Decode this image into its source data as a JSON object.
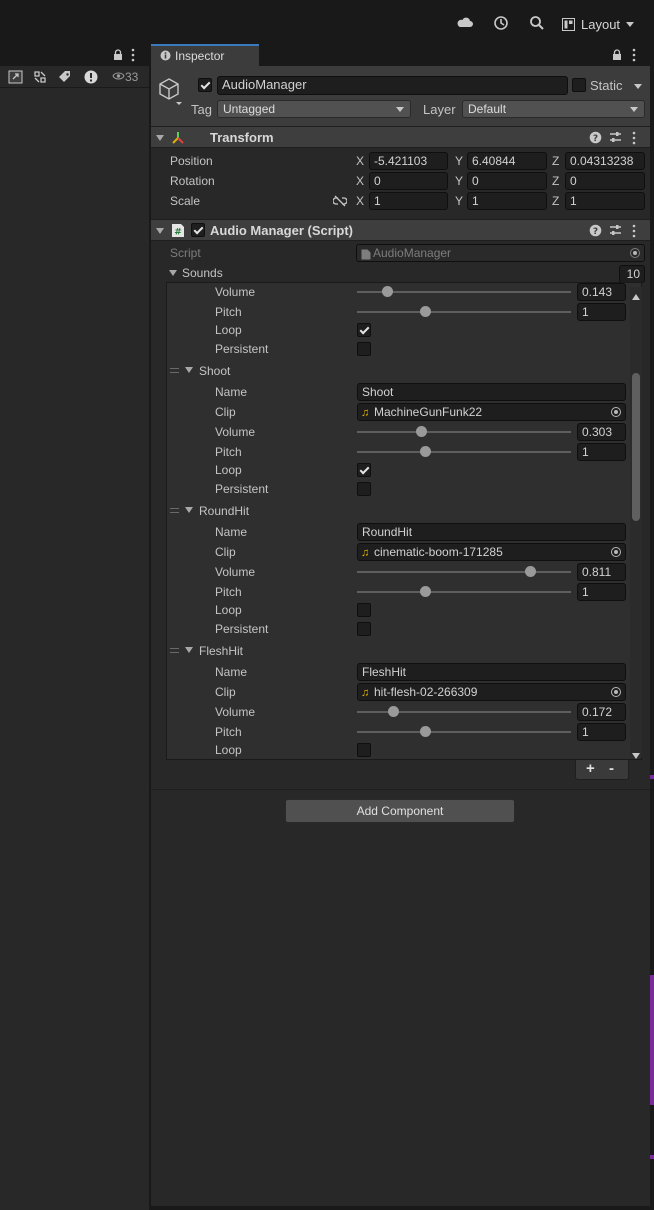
{
  "toolbar": {
    "cloud_icon": "cloud-icon",
    "history_icon": "history-icon",
    "search_icon": "search-icon",
    "layout_label": "Layout"
  },
  "hierarchy": {
    "visibility_count": "33"
  },
  "inspector": {
    "tab_label": "Inspector",
    "object": {
      "name": "AudioManager",
      "active": true,
      "static_label": "Static",
      "tag_label": "Tag",
      "tag_value": "Untagged",
      "layer_label": "Layer",
      "layer_value": "Default"
    },
    "transform": {
      "title": "Transform",
      "position_label": "Position",
      "rotation_label": "Rotation",
      "scale_label": "Scale",
      "axis_x": "X",
      "axis_y": "Y",
      "axis_z": "Z",
      "position": {
        "x": "-5.421103",
        "y": "6.40844",
        "z": "0.04313238"
      },
      "rotation": {
        "x": "0",
        "y": "0",
        "z": "0"
      },
      "scale": {
        "x": "1",
        "y": "1",
        "z": "1"
      }
    },
    "audio_manager": {
      "title": "Audio Manager (Script)",
      "enabled": true,
      "script_label": "Script",
      "script_value": "AudioManager",
      "sounds_label": "Sounds",
      "sounds_count": "10",
      "labels": {
        "name": "Name",
        "clip": "Clip",
        "volume": "Volume",
        "pitch": "Pitch",
        "loop": "Loop",
        "persistent": "Persistent"
      },
      "partial": {
        "volume": 0.143,
        "volume_text": "0.143",
        "pitch": 1,
        "pitch_text": "1",
        "loop": true,
        "persistent": false
      },
      "elements": [
        {
          "title": "Shoot",
          "name": "Shoot",
          "clip": "MachineGunFunk22",
          "volume": 0.303,
          "volume_text": "0.303",
          "pitch": 1,
          "pitch_text": "1",
          "loop": true,
          "persistent": false
        },
        {
          "title": "RoundHit",
          "name": "RoundHit",
          "clip": "cinematic-boom-171285",
          "volume": 0.811,
          "volume_text": "0.811",
          "pitch": 1,
          "pitch_text": "1",
          "loop": false,
          "persistent": false
        },
        {
          "title": "FleshHit",
          "name": "FleshHit",
          "clip": "hit-flesh-02-266309",
          "volume": 0.172,
          "volume_text": "0.172",
          "pitch": 1,
          "pitch_text": "1",
          "loop": false
        }
      ],
      "plus_label": "+",
      "minus_label": "-"
    },
    "add_component_label": "Add Component"
  },
  "colors": {
    "background": "#282828",
    "header": "#3c3c3c",
    "field": "#1e1e1e",
    "accent": "#3a79bb",
    "audio_clip_icon": "#e8b400"
  }
}
